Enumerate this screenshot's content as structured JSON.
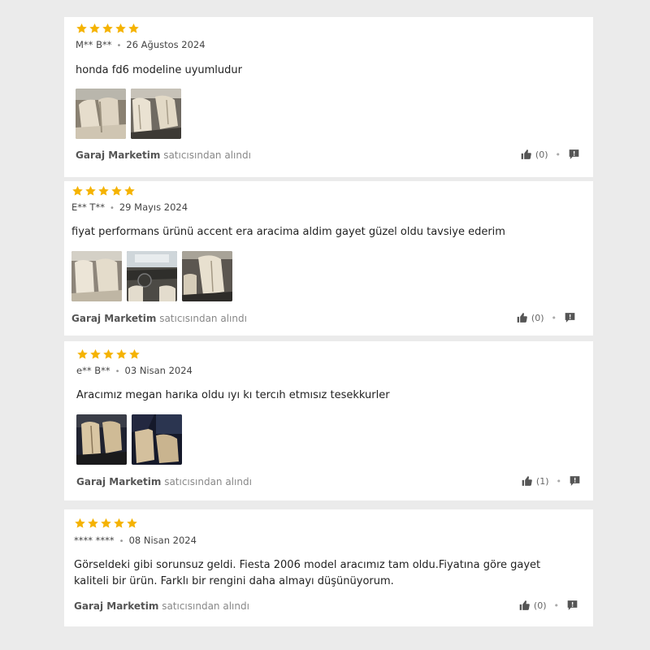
{
  "reviews": [
    {
      "rating": 5,
      "author": "M** B**",
      "date": "26 Ağustos 2024",
      "text": "honda fd6 modeline uyumludur",
      "photos": [
        "seat-beige-rear",
        "seat-beige-front"
      ],
      "seller_name": "Garaj Marketim",
      "seller_suffix": " satıcısından alındı",
      "likes": "(0)"
    },
    {
      "rating": 5,
      "author": "E** T**",
      "date": "29 Mayıs 2024",
      "text": "fiyat performans ürünü accent era aracima aldim gayet güzel oldu tavsiye ederim",
      "photos": [
        "seat-beige-rear",
        "car-interior-dashboard",
        "seat-beige-front"
      ],
      "seller_name": "Garaj Marketim",
      "seller_suffix": " satıcısından alındı",
      "likes": "(0)"
    },
    {
      "rating": 5,
      "author": "e** B**",
      "date": "03 Nisan 2024",
      "text": "Aracımız megan harıka oldu ıyı kı tercıh etmısız tesekkurler",
      "photos": [
        "seat-beige-dark",
        "seat-beige-dark"
      ],
      "seller_name": "Garaj Marketim",
      "seller_suffix": " satıcısından alındı",
      "likes": "(1)"
    },
    {
      "rating": 5,
      "author": "**** ****",
      "date": "08 Nisan 2024",
      "text": "Görseldeki gibi sorunsuz geldi. Fiesta 2006 model aracımız tam oldu.Fiyatına göre gayet kaliteli bir ürün. Farklı bir rengini daha almayı düşünüyorum.",
      "photos": [],
      "seller_name": "Garaj Marketim",
      "seller_suffix": " satıcısından alındı",
      "likes": "(0)"
    }
  ],
  "colors": {
    "star": "#f5b301",
    "background": "#ebebeb",
    "card": "#ffffff"
  },
  "icons": {
    "like": "thumbs-up-icon",
    "report": "report-flag-icon",
    "star": "star-icon"
  }
}
